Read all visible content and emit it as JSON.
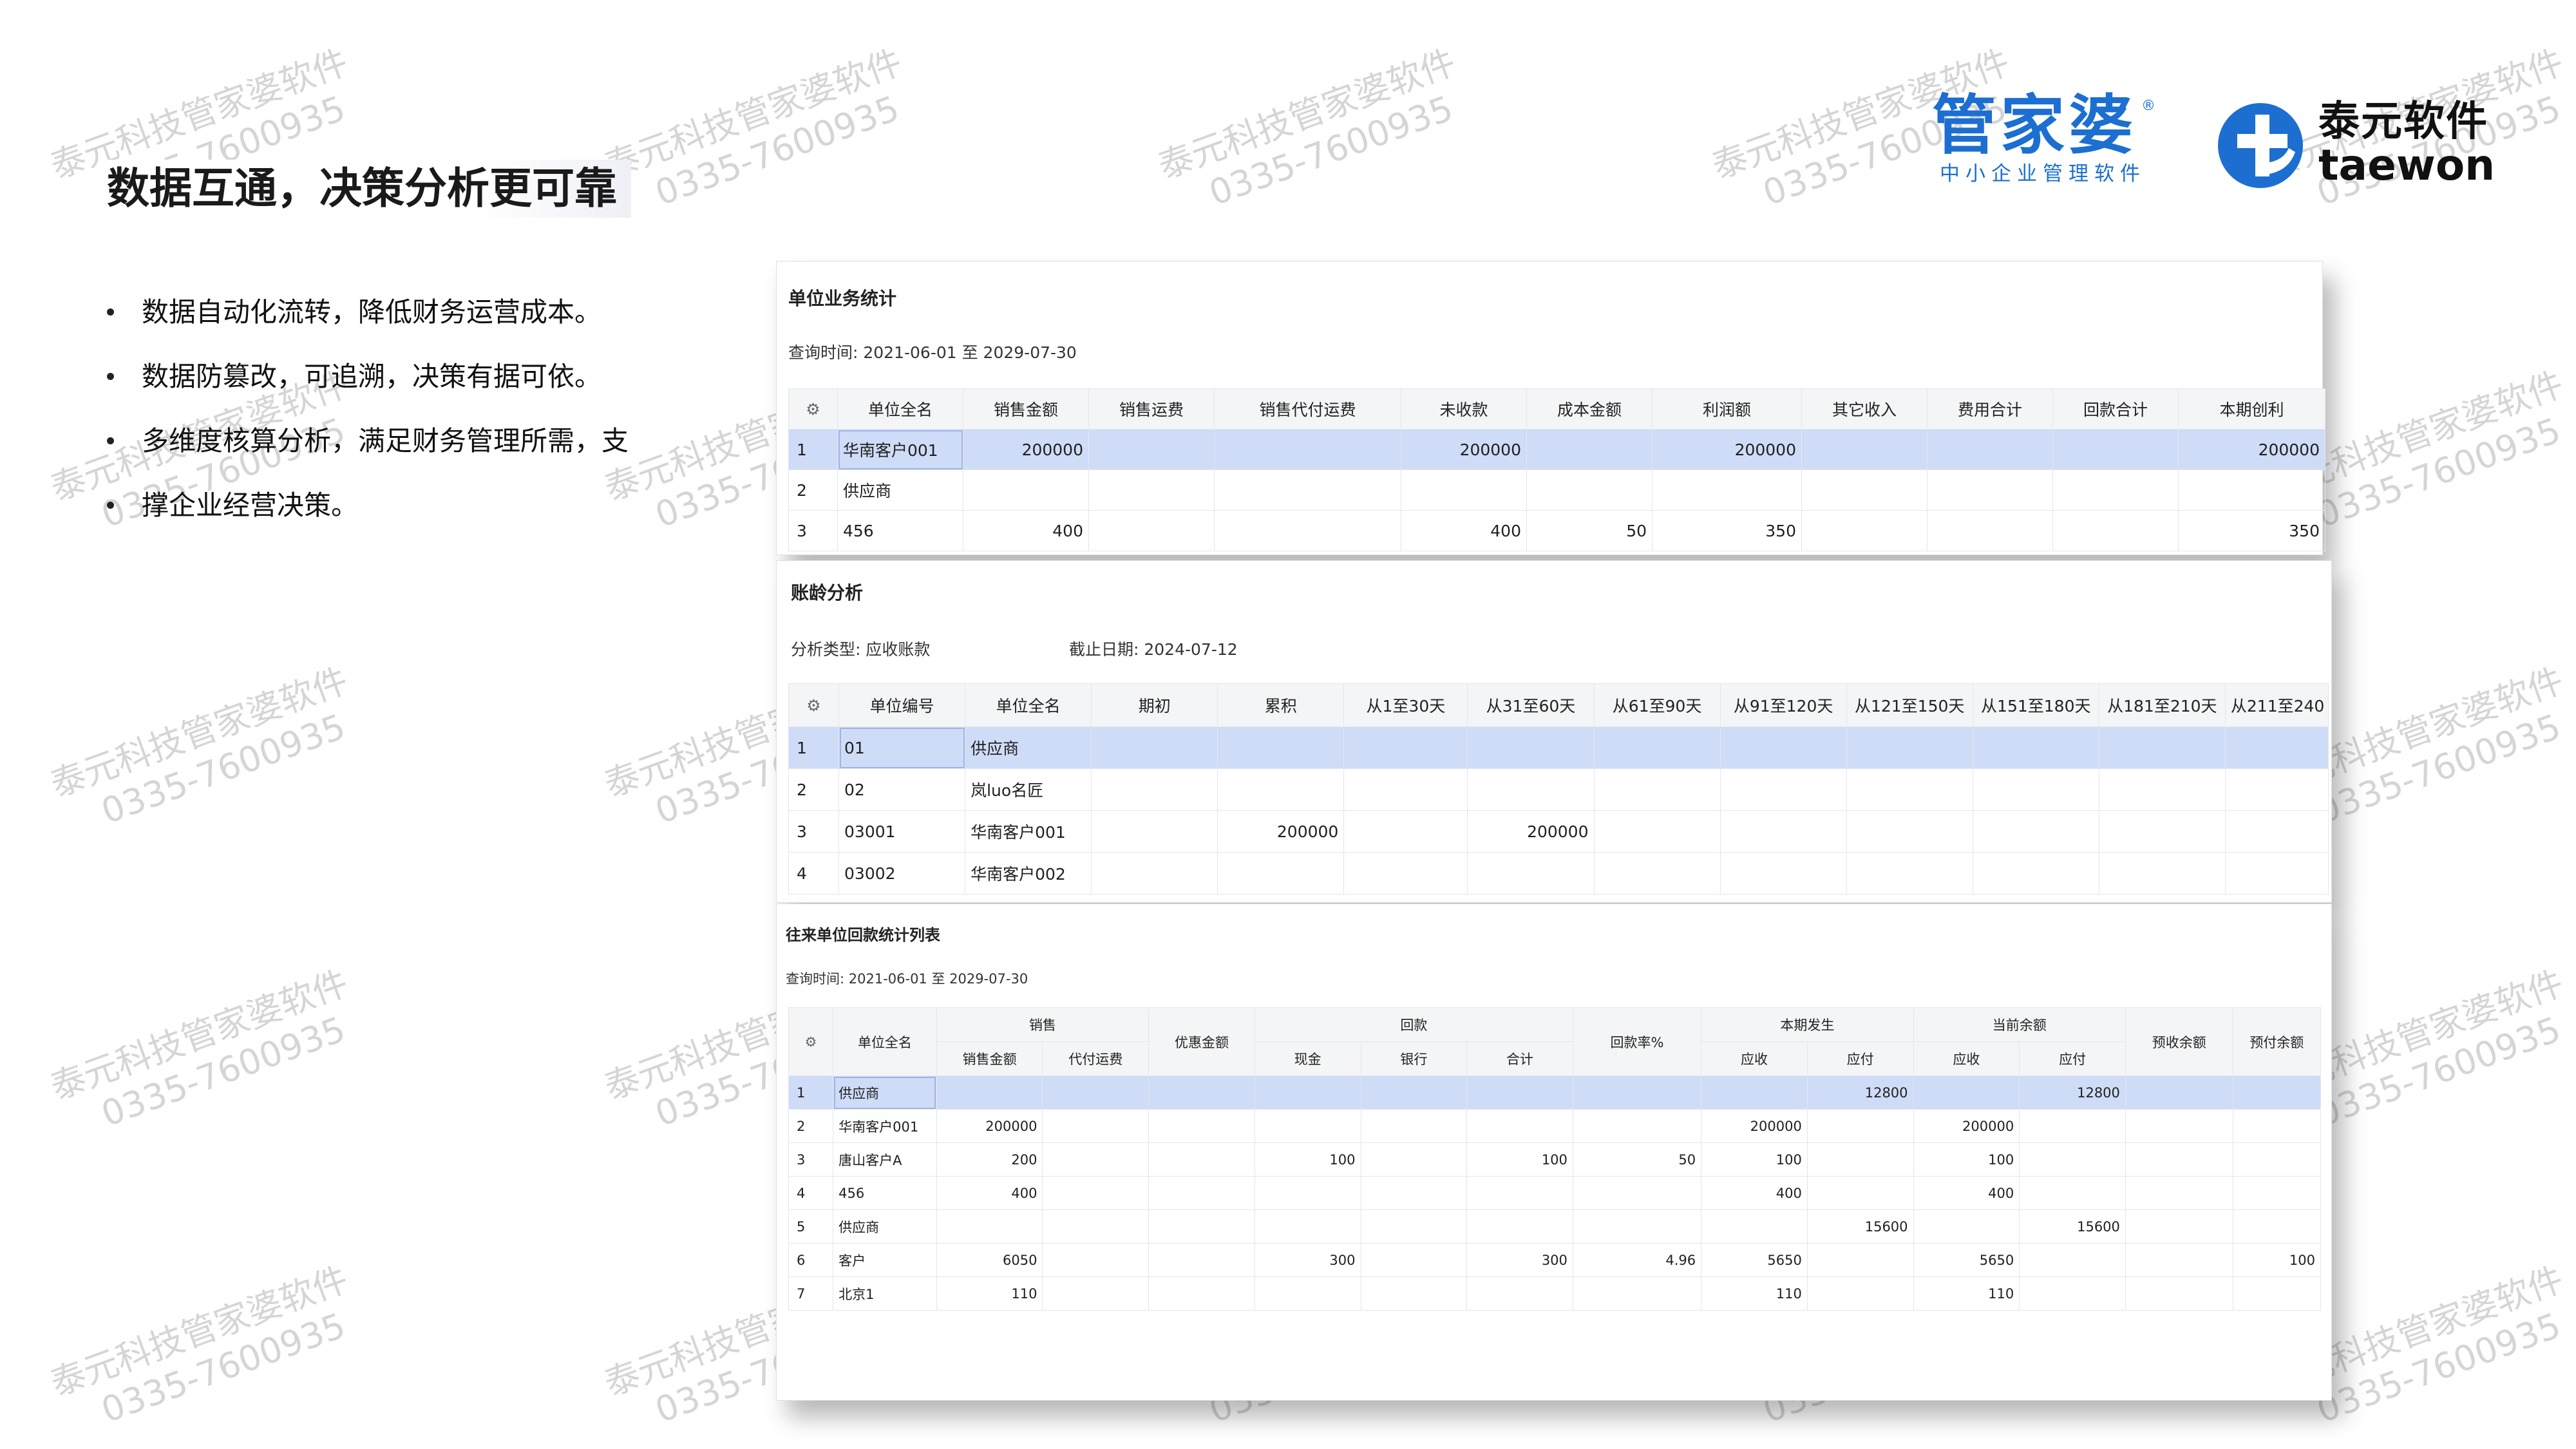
{
  "headline": "数据互通，决策分析更可靠",
  "bullets": [
    "数据自动化流转，降低财务运营成本。",
    "数据防篡改，可追溯，决策有据可依。",
    "多维度核算分析，满足财务管理所需，支",
    "撑企业经营决策。"
  ],
  "watermark": {
    "line1": "泰元科技管家婆软件",
    "line2": "0335-7600935"
  },
  "logos": {
    "gjp": {
      "name": "管家婆",
      "reg": "®",
      "sub": "中小企业管理软件",
      "color": "#1c6fd1"
    },
    "taewon": {
      "cn": "泰元软件",
      "en": "taewon",
      "mark_icon": "taewon-logo-mark",
      "color": "#1c6fd1"
    }
  },
  "panel1": {
    "title": "单位业务统计",
    "query": "查询时间: 2021-06-01 至 2029-07-30",
    "settings_icon": "⚙",
    "columns": [
      "单位全名",
      "销售金额",
      "销售运费",
      "销售代付运费",
      "未收款",
      "成本金额",
      "利润额",
      "其它收入",
      "费用合计",
      "回款合计",
      "本期创利"
    ],
    "rows": [
      [
        "1",
        "华南客户001",
        "200000",
        "",
        "",
        "200000",
        "",
        "200000",
        "",
        "",
        "",
        "200000"
      ],
      [
        "2",
        "供应商",
        "",
        "",
        "",
        "",
        "",
        "",
        "",
        "",
        "",
        ""
      ],
      [
        "3",
        "456",
        "400",
        "",
        "",
        "400",
        "50",
        "350",
        "",
        "",
        "",
        "350"
      ]
    ]
  },
  "panel2": {
    "title": "账龄分析",
    "type_label": "分析类型: 应收账款",
    "date_label": "截止日期: 2024-07-12",
    "settings_icon": "⚙",
    "columns": [
      "单位编号",
      "单位全名",
      "期初",
      "累积",
      "从1至30天",
      "从31至60天",
      "从61至90天",
      "从91至120天",
      "从121至150天",
      "从151至180天",
      "从181至210天",
      "从211至240"
    ],
    "rows": [
      [
        "1",
        "01",
        "供应商",
        "",
        "",
        "",
        "",
        "",
        "",
        "",
        "",
        "",
        ""
      ],
      [
        "2",
        "02",
        "岚luo名匠",
        "",
        "",
        "",
        "",
        "",
        "",
        "",
        "",
        "",
        ""
      ],
      [
        "3",
        "03001",
        "华南客户001",
        "",
        "200000",
        "",
        "200000",
        "",
        "",
        "",
        "",
        "",
        ""
      ],
      [
        "4",
        "03002",
        "华南客户002",
        "",
        "",
        "",
        "",
        "",
        "",
        "",
        "",
        "",
        ""
      ]
    ]
  },
  "panel3": {
    "title": "往来单位回款统计列表",
    "query": "查询时间: 2021-06-01 至 2029-07-30",
    "settings_icon": "⚙",
    "header": {
      "name": "单位全名",
      "sales": "销售",
      "sales_amount": "销售金额",
      "sales_freight": "代付运费",
      "discount": "优惠金额",
      "refund": "回款",
      "cash": "现金",
      "bank": "银行",
      "total": "合计",
      "rate": "回款率%",
      "period": "本期发生",
      "receivable": "应收",
      "payable": "应付",
      "balance": "当前余额",
      "prepay_recv": "预收余额",
      "prepay_pay": "预付余额"
    },
    "rows": [
      [
        "1",
        "供应商",
        "",
        "",
        "",
        "",
        "",
        "",
        "",
        "",
        "12800",
        "",
        "12800",
        "",
        ""
      ],
      [
        "2",
        "华南客户001",
        "200000",
        "",
        "",
        "",
        "",
        "",
        "",
        "200000",
        "",
        "200000",
        "",
        "",
        ""
      ],
      [
        "3",
        "唐山客户A",
        "200",
        "",
        "",
        "100",
        "",
        "100",
        "50",
        "100",
        "",
        "100",
        "",
        "",
        ""
      ],
      [
        "4",
        "456",
        "400",
        "",
        "",
        "",
        "",
        "",
        "",
        "400",
        "",
        "400",
        "",
        "",
        ""
      ],
      [
        "5",
        "供应商",
        "",
        "",
        "",
        "",
        "",
        "",
        "",
        "",
        "15600",
        "",
        "15600",
        "",
        ""
      ],
      [
        "6",
        "客户",
        "6050",
        "",
        "",
        "300",
        "",
        "300",
        "4.96",
        "5650",
        "",
        "5650",
        "",
        "",
        "100"
      ],
      [
        "7",
        "北京1",
        "110",
        "",
        "",
        "",
        "",
        "",
        "",
        "110",
        "",
        "110",
        "",
        "",
        ""
      ]
    ]
  }
}
